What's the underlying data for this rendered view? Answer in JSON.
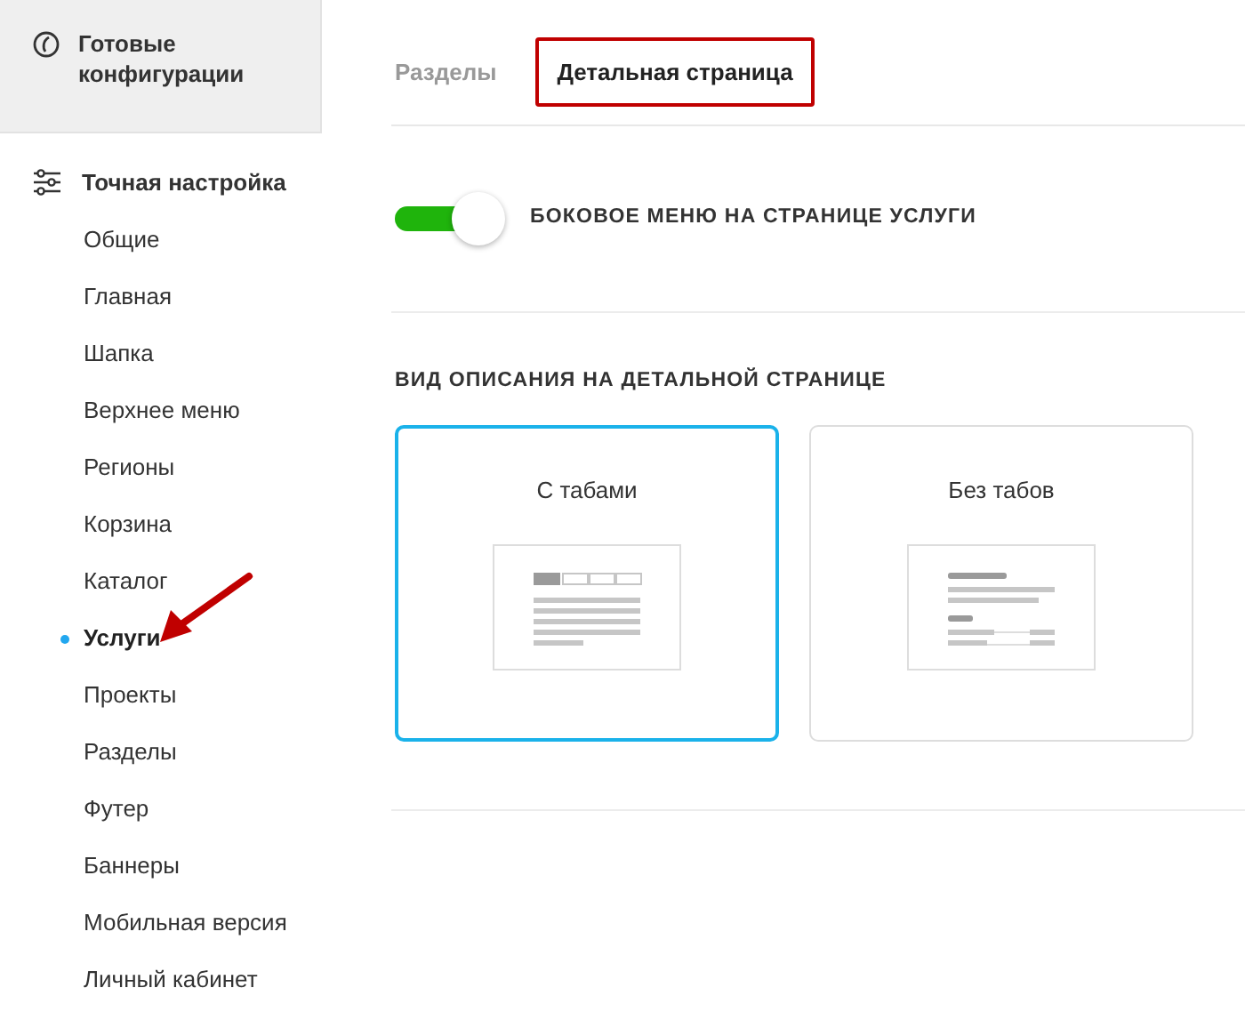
{
  "sidebar": {
    "presets": {
      "label": "Готовые конфигурации"
    },
    "section": {
      "label": "Точная настройка",
      "items": [
        {
          "label": "Общие",
          "selected": false
        },
        {
          "label": "Главная",
          "selected": false
        },
        {
          "label": "Шапка",
          "selected": false
        },
        {
          "label": "Верхнее меню",
          "selected": false
        },
        {
          "label": "Регионы",
          "selected": false
        },
        {
          "label": "Корзина",
          "selected": false
        },
        {
          "label": "Каталог",
          "selected": false
        },
        {
          "label": "Услуги",
          "selected": true
        },
        {
          "label": "Проекты",
          "selected": false
        },
        {
          "label": "Разделы",
          "selected": false
        },
        {
          "label": "Футер",
          "selected": false
        },
        {
          "label": "Баннеры",
          "selected": false
        },
        {
          "label": "Мобильная версия",
          "selected": false
        },
        {
          "label": "Личный кабинет",
          "selected": false
        }
      ]
    }
  },
  "tabs": [
    {
      "label": "Разделы",
      "selected": false
    },
    {
      "label": "Детальная страница",
      "selected": true
    }
  ],
  "toggle": {
    "label": "БОКОВОЕ МЕНЮ НА СТРАНИЦЕ УСЛУГИ",
    "on": true
  },
  "description": {
    "heading": "ВИД ОПИСАНИЯ НА ДЕТАЛЬНОЙ СТРАНИЦЕ",
    "options": [
      {
        "label": "С табами",
        "kind": "tabs",
        "selected": true
      },
      {
        "label": "Без табов",
        "kind": "plain",
        "selected": false
      }
    ]
  }
}
